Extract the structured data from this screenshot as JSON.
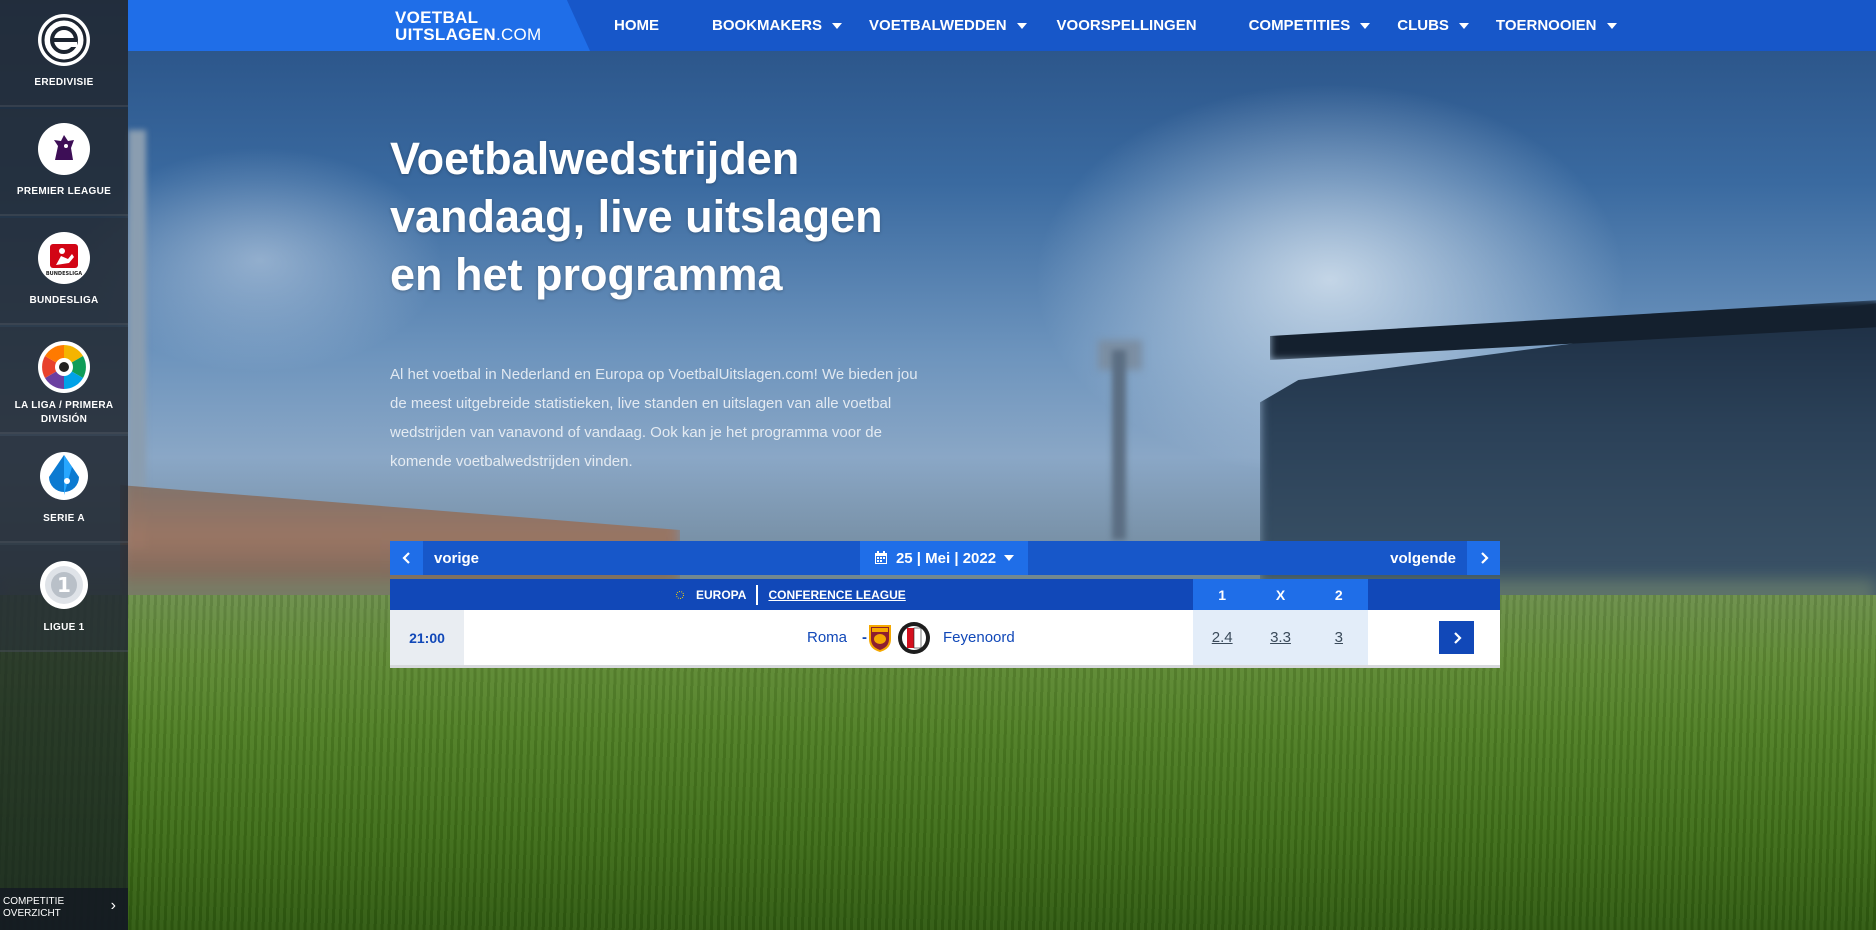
{
  "brand": {
    "line1": "VOETBAL",
    "line2": "UITSLAGEN",
    "suffix": ".COM"
  },
  "nav": [
    {
      "label": "HOME",
      "dropdown": false
    },
    {
      "label": "BOOKMAKERS",
      "dropdown": true
    },
    {
      "label": "VOETBALWEDDEN",
      "dropdown": true
    },
    {
      "label": "VOORSPELLINGEN",
      "dropdown": false
    },
    {
      "label": "COMPETITIES",
      "dropdown": true
    },
    {
      "label": "CLUBS",
      "dropdown": true
    },
    {
      "label": "TOERNOOIEN",
      "dropdown": true
    }
  ],
  "sidebar": {
    "items": [
      {
        "label": "EREDIVISIE",
        "icon": "eredivisie-logo"
      },
      {
        "label": "PREMIER LEAGUE",
        "icon": "premier-league-logo"
      },
      {
        "label": "BUNDESLIGA",
        "icon": "bundesliga-logo"
      },
      {
        "label": "LA LIGA / PRIMERA DIVISIÓN",
        "icon": "la-liga-logo"
      },
      {
        "label": "SERIE A",
        "icon": "serie-a-logo"
      },
      {
        "label": "LIGUE 1",
        "icon": "ligue-1-logo"
      }
    ],
    "bottom": {
      "line1": "COMPETITIE",
      "line2": "OVERZICHT",
      "icon": "chevron-right-icon"
    }
  },
  "hero": {
    "title": "Voetbalwedstrijden vandaag, live uitslagen en het programma",
    "text": "Al het voetbal in Nederland en Europa op VoetbalUitslagen.com! We bieden jou de meest uitgebreide statistieken, live standen en uitslagen van alle voetbal wedstrijden van vanavond of vandaag. Ook kan je het programma voor de komende voetbalwedstrijden vinden."
  },
  "date_nav": {
    "prev": "vorige",
    "next": "volgende",
    "date": "25 | Mei | 2022"
  },
  "competition": {
    "region": "EUROPA",
    "league": "CONFERENCE LEAGUE",
    "odds_headers": [
      "1",
      "X",
      "2"
    ]
  },
  "matches": [
    {
      "time": "21:00",
      "home": "Roma",
      "separator": "-",
      "away": "Feyenoord",
      "odds": [
        "2.4",
        "3.3",
        "3"
      ]
    }
  ],
  "colors": {
    "nav_bg": "#1757c9",
    "accent": "#1f6ee8",
    "dark_blue": "#1148b8"
  }
}
